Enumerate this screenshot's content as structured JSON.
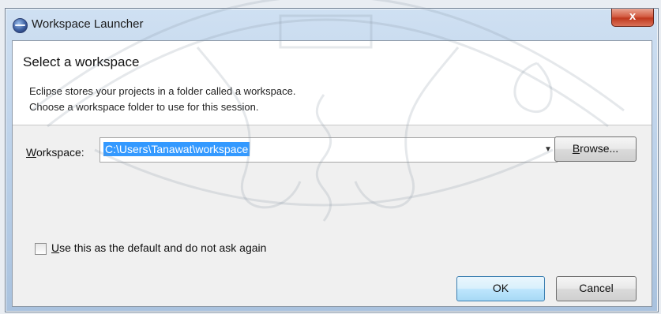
{
  "window": {
    "title": "Workspace Launcher",
    "close_glyph": "x"
  },
  "header": {
    "title": "Select a workspace",
    "description_line1": "Eclipse stores your projects in a folder called a workspace.",
    "description_line2": "Choose a workspace folder to use for this session."
  },
  "workspace": {
    "label_mnemonic": "W",
    "label_rest": "orkspace:",
    "value": "C:\\Users\\Tanawat\\workspace",
    "browse_mnemonic": "B",
    "browse_rest": "rowse..."
  },
  "default_checkbox": {
    "mnemonic": "U",
    "label_rest": "se this as the default and do not ask again",
    "checked": false
  },
  "buttons": {
    "ok": "OK",
    "cancel": "Cancel"
  },
  "icons": {
    "app": "eclipse-icon",
    "dropdown": "chevron-down-icon"
  },
  "colors": {
    "selection": "#3399ff",
    "close_button": "#c0391f",
    "title_bar": "#b9cfe8"
  }
}
